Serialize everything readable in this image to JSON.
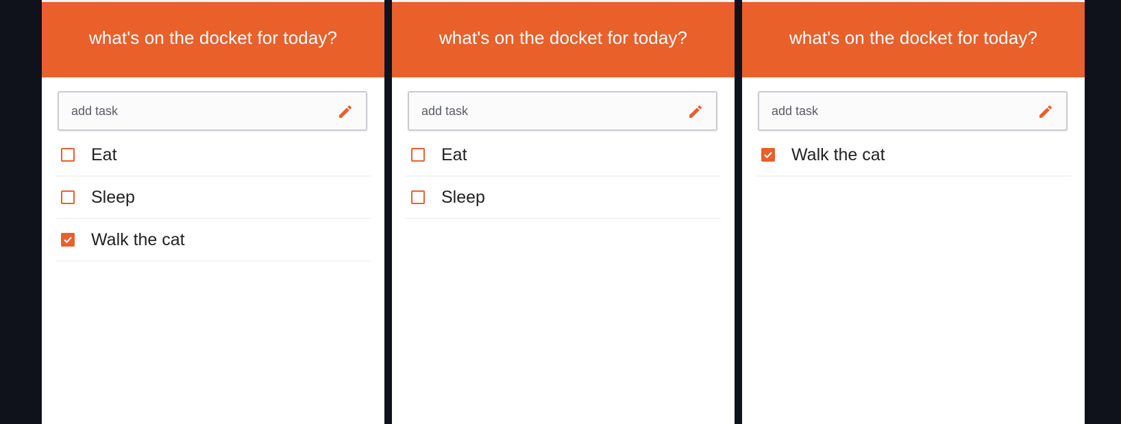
{
  "colors": {
    "accent": "#e9602b",
    "background": "#0f121a",
    "panel": "#ffffff"
  },
  "panels": [
    {
      "header_title": "what's on the docket for today?",
      "input": {
        "placeholder": "add task",
        "value": "",
        "icon": "pencil-icon"
      },
      "tasks": [
        {
          "label": "Eat",
          "checked": false
        },
        {
          "label": "Sleep",
          "checked": false
        },
        {
          "label": "Walk the cat",
          "checked": true
        }
      ]
    },
    {
      "header_title": "what's on the docket for today?",
      "input": {
        "placeholder": "add task",
        "value": "",
        "icon": "pencil-icon"
      },
      "tasks": [
        {
          "label": "Eat",
          "checked": false
        },
        {
          "label": "Sleep",
          "checked": false
        }
      ]
    },
    {
      "header_title": "what's on the docket for today?",
      "input": {
        "placeholder": "add task",
        "value": "",
        "icon": "pencil-icon"
      },
      "tasks": [
        {
          "label": "Walk the cat",
          "checked": true
        }
      ]
    }
  ]
}
